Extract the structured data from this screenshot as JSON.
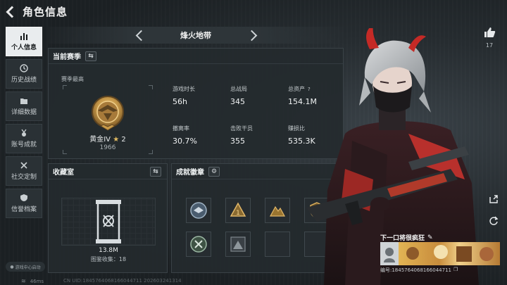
{
  "header": {
    "title": "角色信息"
  },
  "sidebar": {
    "items": [
      {
        "label": "个人信息",
        "icon": "bar-chart-icon",
        "active": true
      },
      {
        "label": "历史战绩",
        "icon": "history-icon",
        "active": false
      },
      {
        "label": "详细数据",
        "icon": "folder-icon",
        "active": false
      },
      {
        "label": "账号成就",
        "icon": "medal-icon",
        "active": false
      },
      {
        "label": "社交定制",
        "icon": "tools-icon",
        "active": false
      },
      {
        "label": "信誉档案",
        "icon": "shield-icon",
        "active": false
      }
    ],
    "game_center_label": "游戏中心启动"
  },
  "map_selector": {
    "current": "烽火地带"
  },
  "season": {
    "title": "当前赛季",
    "subtitle": "赛季最高",
    "rank_name": "黄金IV",
    "rank_stars": "2",
    "rank_score": "1966",
    "stats": [
      {
        "label": "游戏时长",
        "value": "56h"
      },
      {
        "label": "总战局",
        "value": "345"
      },
      {
        "label": "总资产",
        "value": "154.1M",
        "help": "?"
      },
      {
        "label": "撤离率",
        "value": "30.7%"
      },
      {
        "label": "击败干员",
        "value": "355"
      },
      {
        "label": "赚损比",
        "value": "535.3K"
      }
    ]
  },
  "collection": {
    "title": "收藏室",
    "value": "13.8M",
    "count_label": "图鉴收集：18"
  },
  "badges": {
    "title": "成就徽章"
  },
  "social": {
    "like_count": "17"
  },
  "banner": {
    "title": "下一口将很疯狂",
    "id_text": "编号:1845764068166044711"
  },
  "status": {
    "ping": "46ms",
    "uid": "CN UID:1845764068166044711 202603241314"
  },
  "colors": {
    "accent_gold": "#c89a4a",
    "active_tab": "#e9ecee",
    "panel_bg": "#242a2e"
  }
}
